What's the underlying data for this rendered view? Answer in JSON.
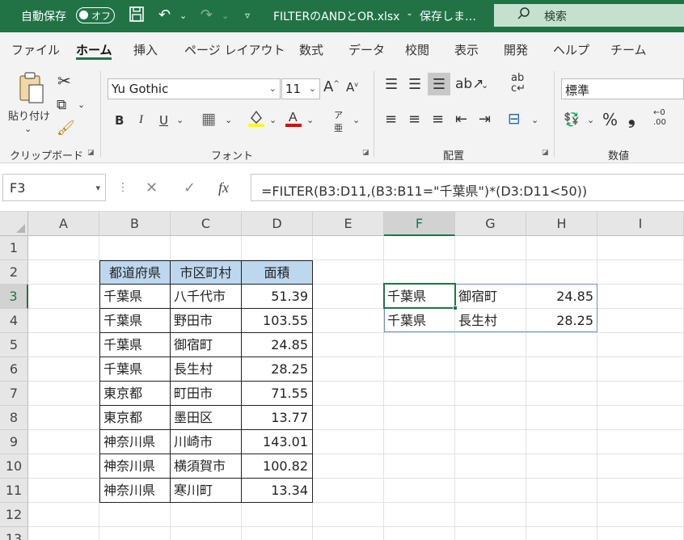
{
  "titlebar": {
    "autosave_label": "自動保存",
    "autosave_state": "オフ",
    "filename": "FILTERのANDとOR.xlsx",
    "separator": "-",
    "save_status": "保存しま…",
    "search_placeholder": "検索"
  },
  "tabs": [
    "ファイル",
    "ホーム",
    "挿入",
    "ページ レイアウト",
    "数式",
    "データ",
    "校閲",
    "表示",
    "開発",
    "ヘルプ",
    "チーム"
  ],
  "active_tab": "ホーム",
  "ribbon": {
    "clipboard": {
      "paste_label": "貼り付け",
      "group_label": "クリップボード"
    },
    "font": {
      "font_name": "Yu Gothic",
      "font_size": "11",
      "group_label": "フォント",
      "bold": "B",
      "italic": "I",
      "underline": "U",
      "phonetic_label": "亜"
    },
    "alignment": {
      "group_label": "配置"
    },
    "number": {
      "format": "標準",
      "group_label": "数値"
    }
  },
  "formula_bar": {
    "name_box": "F3",
    "formula": "=FILTER(B3:D11,(B3:B11=\"千葉県\")*(D3:D11<50))"
  },
  "columns": [
    "A",
    "B",
    "C",
    "D",
    "E",
    "F",
    "G",
    "H",
    "I"
  ],
  "rows": [
    "1",
    "2",
    "3",
    "4",
    "5",
    "6",
    "7",
    "8",
    "9",
    "10",
    "11",
    "12",
    "13"
  ],
  "selected_column": "F",
  "selected_row": "3",
  "table": {
    "headers": [
      "都道府県",
      "市区町村",
      "面積"
    ],
    "rows": [
      [
        "千葉県",
        "八千代市",
        "51.39"
      ],
      [
        "千葉県",
        "野田市",
        "103.55"
      ],
      [
        "千葉県",
        "御宿町",
        "24.85"
      ],
      [
        "千葉県",
        "長生村",
        "28.25"
      ],
      [
        "東京都",
        "町田市",
        "71.55"
      ],
      [
        "東京都",
        "墨田区",
        "13.77"
      ],
      [
        "神奈川県",
        "川崎市",
        "143.01"
      ],
      [
        "神奈川県",
        "横須賀市",
        "100.82"
      ],
      [
        "神奈川県",
        "寒川町",
        "13.34"
      ]
    ]
  },
  "result": {
    "rows": [
      [
        "千葉県",
        "御宿町",
        "24.85"
      ],
      [
        "千葉県",
        "長生村",
        "28.25"
      ]
    ]
  },
  "colors": {
    "excel_green": "#217346",
    "header_fill": "#bdd7ee",
    "spill_border": "#6b8ed6"
  }
}
